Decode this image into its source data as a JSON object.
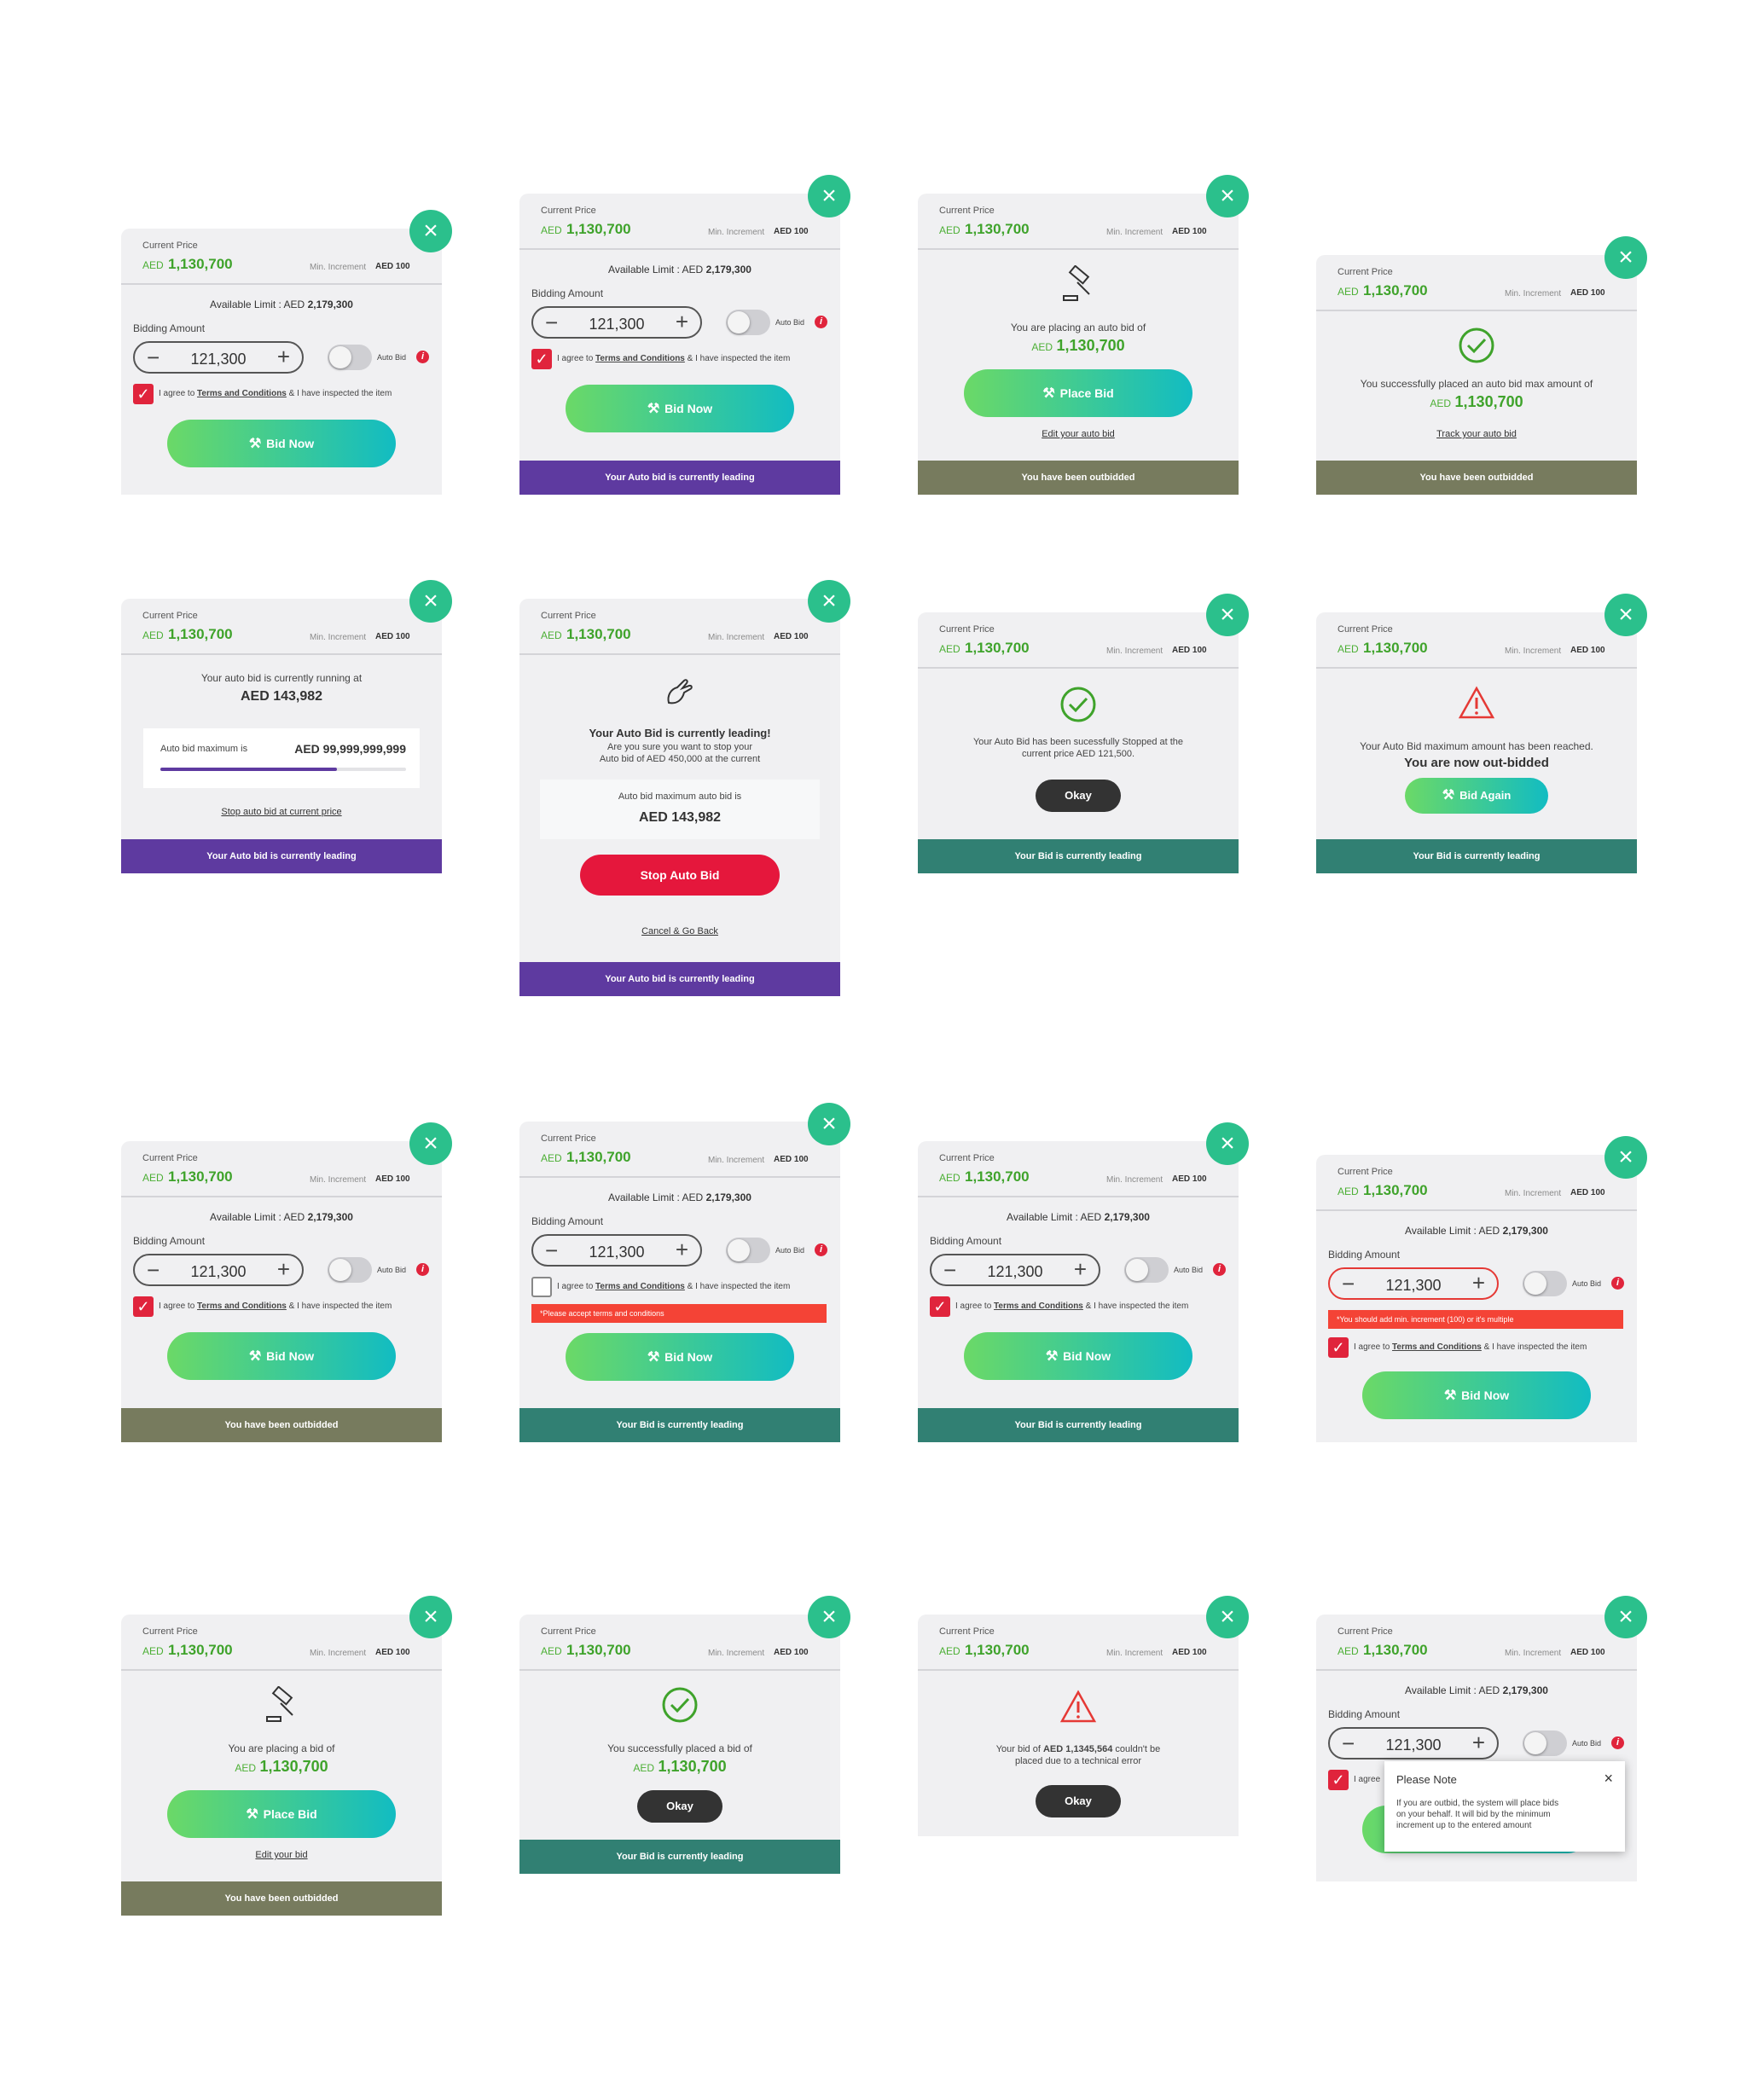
{
  "common": {
    "current_price_label": "Current Price",
    "currency": "AED",
    "price": "1,130,700",
    "min_increment_label": "Min. Increment",
    "min_increment_value": "AED 100",
    "available_limit_label": "Available Limit : AED",
    "available_limit_value": "2,179,300",
    "bidding_amount_label": "Bidding Amount",
    "bid_amount": "121,300",
    "auto_bid_label": "Auto Bid",
    "agree_prefix": "I agree to",
    "terms_link": "Terms and Conditions",
    "agree_suffix": "& I have inspected the item",
    "bid_now_label": "Bid Now",
    "place_bid_label": "Place Bid",
    "okay_label": "Okay",
    "minus_symbol": "−",
    "plus_symbol": "+",
    "close_symbol": "×",
    "check_symbol": "✓",
    "info_symbol": "i"
  },
  "footers": {
    "auto_leading": "Your Auto bid is currently leading",
    "outbidded": "You have been outbidded",
    "bid_leading": "Your Bid is currently leading"
  },
  "auto_confirm": {
    "text": "You are placing an auto bid of",
    "amount": "1,130,700",
    "edit_link": "Edit your auto bid"
  },
  "auto_success": {
    "text": "You successfully placed an auto bid max amount of",
    "amount": "1,130,700",
    "track_link": "Track your auto bid"
  },
  "auto_running": {
    "text": "Your auto bid is currently running at",
    "amount": "AED 143,982",
    "max_label": "Auto bid maximum is",
    "max_value": "AED 99,999,999,999",
    "progress": 0.72,
    "stop_link": "Stop auto bid at current price"
  },
  "stop_confirm": {
    "title": "Your Auto Bid is currently leading!",
    "line1": "Are you sure you want to stop your",
    "line2": "Auto bid of AED 450,000 at the current",
    "max_label": "Auto bid maximum auto bid is",
    "max_value": "AED 143,982",
    "stop_button": "Stop Auto Bid",
    "cancel_link": "Cancel & Go Back"
  },
  "auto_stopped": {
    "line1": "Your Auto Bid has been sucessfully Stopped at the",
    "line2": "current price AED 121,500."
  },
  "auto_max_reached": {
    "line1": "Your Auto Bid maximum amount has been reached.",
    "line2": "You are now out-bidded",
    "bid_again": "Bid Again"
  },
  "errors": {
    "terms": "*Please accept terms and conditions",
    "increment": "*You should add min. increment (100) or it's multiple"
  },
  "bid_confirm": {
    "text": "You are placing a bid of",
    "amount": "1,130,700",
    "edit_link": "Edit your bid"
  },
  "bid_success": {
    "text": "You successfully placed a bid of",
    "amount": "1,130,700"
  },
  "bid_error": {
    "prefix": "Your bid of",
    "amount": "AED 1,1345,564",
    "suffix": "couldn't be",
    "line2": "placed due to a technical error"
  },
  "note_popup": {
    "title": "Please Note",
    "close": "×",
    "agree_partial": "I agree",
    "body_line1": "If you are outbid, the system will place bids",
    "body_line2": "on your behalf. It will bid by the minimum",
    "body_line3": "increment up to the entered amount"
  },
  "colors": {
    "accent_green": "#3fa32b",
    "close_teal": "#2bc08c",
    "footer_purple": "#5e3aa0",
    "footer_olive": "#777b5e",
    "footer_teal": "#318073",
    "danger_red": "#e5173c"
  }
}
